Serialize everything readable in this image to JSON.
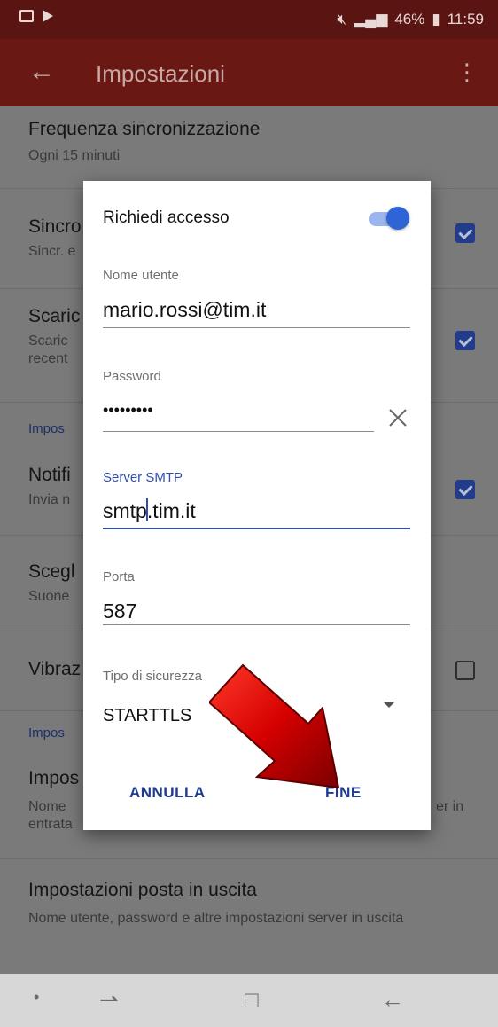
{
  "status_bar": {
    "time": "11:59",
    "battery": "46%",
    "signal_text": "⋯",
    "icons": [
      "gallery-icon",
      "play-store-icon",
      "mute-icon",
      "signal-icon",
      "battery-icon"
    ]
  },
  "app_bar": {
    "title": "Impostazioni",
    "back_icon": "arrow-back-icon",
    "more_icon": "more-vert-icon"
  },
  "settings": {
    "sync_frequency": {
      "title": "Frequenza sincronizzazione",
      "subtitle": "Ogni 15 minuti"
    },
    "sync": {
      "title": "Sincro",
      "subtitle": "Sincr. e"
    },
    "download": {
      "title": "Scaric",
      "subtitle": "Scaric",
      "subtitle2": "recent"
    },
    "section1": "Impos",
    "notifications": {
      "title": "Notifi",
      "subtitle": "Invia n"
    },
    "ringtone": {
      "title": "Scegl",
      "subtitle": "Suone"
    },
    "vibrate": {
      "title": "Vibraz"
    },
    "section2": "Impos",
    "incoming": {
      "title": "Impos",
      "subtitle": "Nome",
      "subtitle2": "entrata",
      "tail": "er in"
    },
    "outgoing": {
      "title": "Impostazioni posta in uscita",
      "subtitle": "Nome utente, password e altre impostazioni server in uscita"
    }
  },
  "dialog": {
    "require_access_label": "Richiedi accesso",
    "require_access_on": true,
    "username_label": "Nome utente",
    "username_value": "mario.rossi@tim.it",
    "password_label": "Password",
    "password_value": "•••••••••",
    "smtp_label": "Server SMTP",
    "smtp_value_before_cursor": "smtp",
    "smtp_value_after_cursor": ".tim.it",
    "port_label": "Porta",
    "port_value": "587",
    "security_label": "Tipo di sicurezza",
    "security_value": "STARTTLS",
    "cancel_button": "ANNULLA",
    "done_button": "FINE"
  },
  "colors": {
    "accent": "#2f4db2",
    "app_bar": "#6a1814",
    "arrow": "#d40000"
  },
  "nav_bar": {
    "icons": [
      "dot-icon",
      "recent-apps-icon",
      "home-icon",
      "back-icon"
    ]
  }
}
